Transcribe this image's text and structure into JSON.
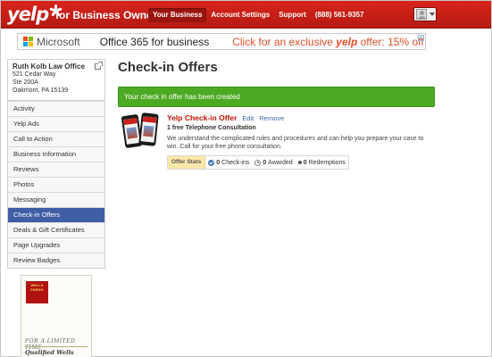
{
  "header": {
    "logo_text": "yelp",
    "business_title": "for Business Owners",
    "nav": [
      {
        "label": "Your Business",
        "active": true
      },
      {
        "label": "Account Settings",
        "active": false
      },
      {
        "label": "Support",
        "active": false
      }
    ],
    "phone": "(888) 561-9357"
  },
  "ad_banner": {
    "brand": "Microsoft",
    "product": "Office 365 for business",
    "cta_prefix": "Click for an exclusive",
    "cta_brand": "yelp",
    "cta_suffix": "offer: 15% off",
    "close_icon": "x"
  },
  "business": {
    "name": "Ruth Kolb Law Office",
    "address_line1": "521 Cedar Way",
    "address_line2": "Ste 200A",
    "address_line3": "Oakmont, PA 15139"
  },
  "sidebar": {
    "items": [
      {
        "label": "Activity"
      },
      {
        "label": "Yelp Ads"
      },
      {
        "label": "Call to Action"
      },
      {
        "label": "Business Information"
      },
      {
        "label": "Reviews"
      },
      {
        "label": "Photos"
      },
      {
        "label": "Messaging"
      },
      {
        "label": "Check-in Offers"
      },
      {
        "label": "Deals & Gift Certificates"
      },
      {
        "label": "Page Upgrades"
      },
      {
        "label": "Review Badges"
      }
    ],
    "active_index": 7
  },
  "side_ad": {
    "logo_line1": "WELLS",
    "logo_line2": "FARGO",
    "line1": "FOR A LIMITED TIME",
    "line2": "Qualified Wells Fargo"
  },
  "main": {
    "title": "Check-in Offers",
    "alert": "Your check in offer has been created",
    "offer": {
      "title": "Yelp Check-in Offer",
      "edit_label": "Edit",
      "remove_label": "Remove",
      "subtitle": "1 free Telephone Consultation",
      "description": "We understand the complicated rules and procedures and can help you prepare your case to win. Call for your free phone consultation.",
      "stats_label": "Offer Stats",
      "checkins_count": "0",
      "checkins_label": "Check-ins",
      "awarded_count": "0",
      "awarded_label": "Awarded",
      "redemptions_count": "0",
      "redemptions_label": "Redemptions"
    }
  },
  "colors": {
    "brand_red": "#c41200",
    "active_menu": "#3f5ea5",
    "success_green": "#4caa22",
    "link_blue": "#3b65a7"
  }
}
